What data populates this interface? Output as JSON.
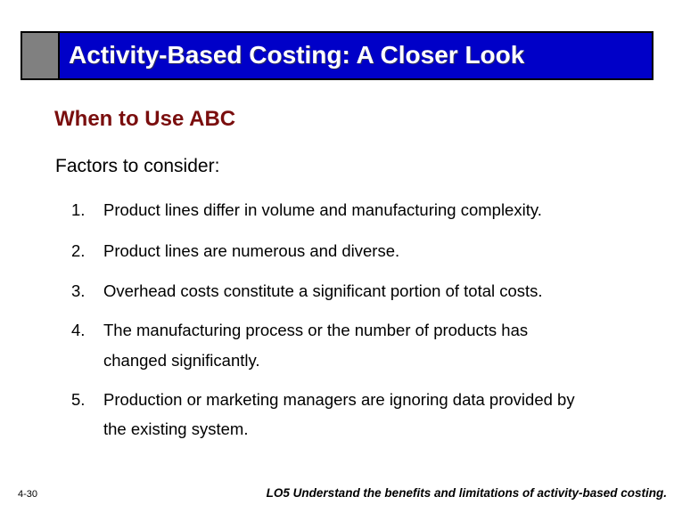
{
  "slide": {
    "title": "Activity-Based Costing: A Closer Look",
    "subheading": "When to Use ABC",
    "intro": "Factors to consider:",
    "items": [
      {
        "num": "1.",
        "line1": "Product lines differ in volume and manufacturing complexity.",
        "line2": ""
      },
      {
        "num": "2.",
        "line1": "Product lines are numerous and diverse.",
        "line2": ""
      },
      {
        "num": "3.",
        "line1": "Overhead costs constitute a significant portion of total costs.",
        "line2": ""
      },
      {
        "num": "4.",
        "line1": "The manufacturing process or the number of products has",
        "line2": "changed significantly."
      },
      {
        "num": "5.",
        "line1": "Production or marketing managers are ignoring data provided by",
        "line2": "the existing system."
      }
    ],
    "page_number": "4-30",
    "learning_objective": "LO5  Understand the benefits and limitations of activity-based costing."
  },
  "colors": {
    "banner_blue": "#0000c8",
    "banner_gray": "#808080",
    "subheading": "#7a0e0e"
  }
}
